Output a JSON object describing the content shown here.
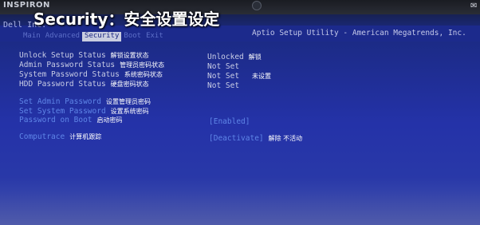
{
  "overlay": {
    "title": "Security：安全设置设定"
  },
  "bezel": {
    "brand": "INSPIRON",
    "corner_icon": "✉"
  },
  "bios": {
    "vendor_short": "Dell Inc.",
    "utility": "Aptio Setup Utility - American Megatrends, Inc.",
    "tabs": [
      {
        "label": "Main"
      },
      {
        "label": "Advanced"
      },
      {
        "label": "Security",
        "active": true
      },
      {
        "label": "Boot"
      },
      {
        "label": "Exit"
      }
    ],
    "status_rows": [
      {
        "label": "Unlock Setup Status",
        "cn": "解锁设置状态",
        "value": "Unlocked",
        "value_cn": "解锁"
      },
      {
        "label": "Admin Password Status",
        "cn": "管理员密码状态",
        "value": "Not Set",
        "value_cn": ""
      },
      {
        "label": "System Password Status",
        "cn": "系统密码状态",
        "value": "Not Set",
        "value_cn": "未设置"
      },
      {
        "label": "HDD Password Status",
        "cn": "硬盘密码状态",
        "value": "Not Set",
        "value_cn": ""
      }
    ],
    "action_rows": [
      {
        "label": "Set Admin Password",
        "cn": "设置管理员密码"
      },
      {
        "label": "Set System Password",
        "cn": "设置系统密码"
      }
    ],
    "password_on_boot": {
      "label": "Password on Boot",
      "cn": "启动密码",
      "value": "[Enabled]"
    },
    "computrace": {
      "label": "Computrace",
      "cn": "计算机跟踪",
      "value": "[Deactivate]",
      "value_cn": "解除 不活动"
    }
  },
  "colors": {
    "background": "#2432a8",
    "link_text": "#5f86e8",
    "plain_text": "#c9cde6",
    "active_tab_bg": "#c9cde0"
  }
}
